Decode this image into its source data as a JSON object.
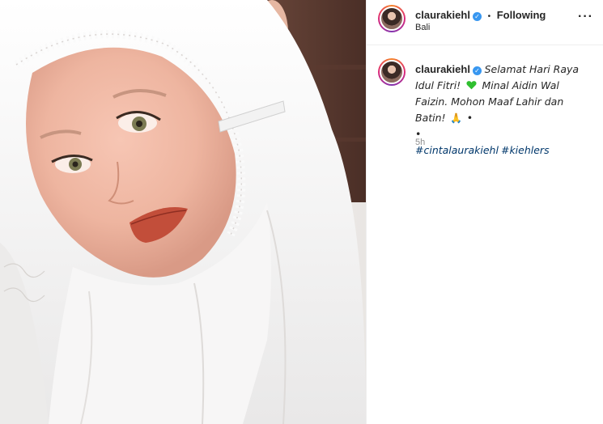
{
  "post": {
    "image_alt": "photo",
    "author": {
      "username": "claurakiehl",
      "verified_icon": "verified-badge-icon",
      "follow_status": "Following",
      "location": "Bali"
    },
    "caption": {
      "username": "claurakiehl",
      "line1": "Selamat Hari Raya Idul Fitri!",
      "line2": "Minal Aidin Wal Faizin. Mohon Maaf Lahir dan Batin!",
      "line3": "•",
      "line4": "•",
      "hashtags": [
        "#cintalaurakiehl",
        "#kiehlers"
      ],
      "emoji_heart_color": "#2fbf2f",
      "emoji_pray": "🙏"
    },
    "time": "5h",
    "more_icon": "more-options-icon",
    "colors": {
      "link": "#00376b",
      "verified": "#3897f0",
      "muted": "#8e8e8e"
    }
  }
}
